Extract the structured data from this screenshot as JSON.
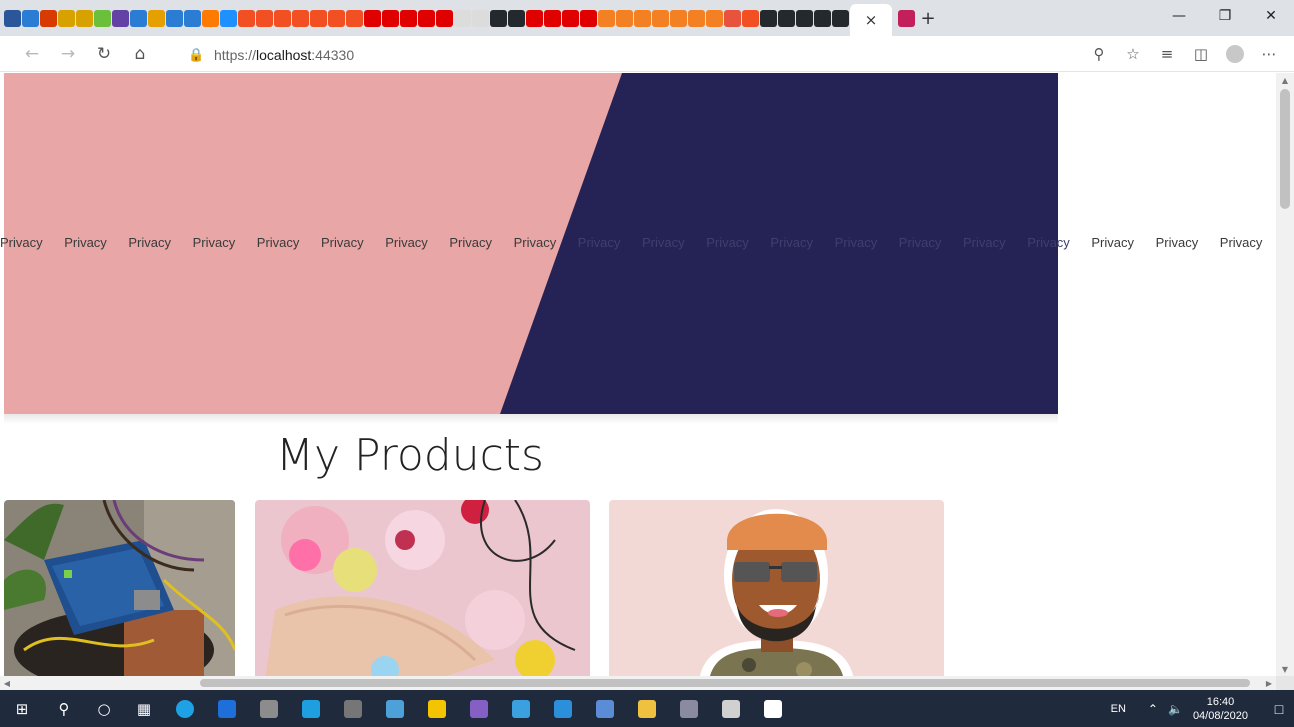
{
  "browser": {
    "url_host": "https://",
    "url_main": "localhost",
    "url_port": ":44330",
    "close_tab_label": "×",
    "new_tab_label": "+",
    "tab_favicon_colors": [
      "#2b579a",
      "#2b7cd3",
      "#d83b01",
      "#d7a100",
      "#d7a100",
      "#6cbf3a",
      "#6441a5",
      "#2b7cd3",
      "#e5a000",
      "#2b7cd3",
      "#2b7cd3",
      "#ff7a00",
      "#1e90ff",
      "#f25022",
      "#f25022",
      "#f25022",
      "#f25022",
      "#f25022",
      "#f25022",
      "#f25022",
      "#e00000",
      "#e00000",
      "#e00000",
      "#e00000",
      "#e00000",
      "#dcdcdc",
      "#dcdcdc",
      "#24292e",
      "#24292e",
      "#e00000",
      "#e00000",
      "#e00000",
      "#e00000",
      "#f48024",
      "#f48024",
      "#f48024",
      "#f48024",
      "#f48024",
      "#f48024",
      "#f48024",
      "#e8533d",
      "#f25022",
      "#24292e",
      "#24292e",
      "#24292e",
      "#24292e",
      "#24292e"
    ],
    "extra_tab_color": "#c21f5b"
  },
  "page": {
    "privacy_label": "Privacy",
    "privacy_count": 20,
    "heading": "My Products",
    "hero_colors": {
      "left": "#e8a6a6",
      "right": "#252255"
    }
  },
  "taskbar": {
    "lang": "EN",
    "time": "16:40",
    "date": "04/08/2020",
    "apps": [
      "edge-icon",
      "ie-icon",
      "usb-icon",
      "skype-icon",
      "calculator-icon",
      "snip-icon",
      "sticky-icon",
      "visual-studio-icon",
      "vs-tool-icon",
      "vscode-icon",
      "remote-icon",
      "explorer-icon",
      "file-icon",
      "media-icon",
      "docs-icon"
    ],
    "app_colors": [
      "#1fa1e6",
      "#1e6fd9",
      "#8c8c8c",
      "#1ea0e0",
      "#767676",
      "#4ea0d8",
      "#f5c400",
      "#865fc5",
      "#3aa0e0",
      "#2b8fd9",
      "#5b8dd6",
      "#f0c040",
      "#8a8aa0",
      "#d0d0d0",
      "#ffffff"
    ]
  }
}
